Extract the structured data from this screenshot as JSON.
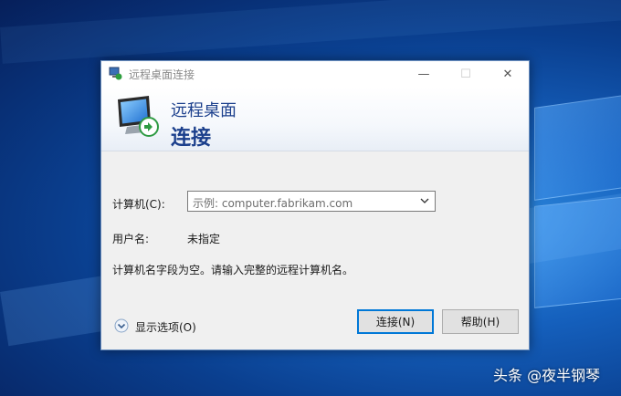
{
  "window": {
    "title": "远程桌面连接",
    "icon": "remote-desktop-icon",
    "controls": {
      "minimize_glyph": "—",
      "maximize_glyph": "☐",
      "close_glyph": "✕"
    }
  },
  "banner": {
    "line1": "远程桌面",
    "line2": "连接"
  },
  "form": {
    "computer_label": "计算机(C):",
    "computer_value": "示例: computer.fabrikam.com",
    "username_label": "用户名:",
    "username_value": "未指定",
    "message": "计算机名字段为空。请输入完整的远程计算机名。"
  },
  "footer": {
    "show_options": "显示选项(O)",
    "connect_button": "连接(N)",
    "help_button": "帮助(H)"
  },
  "watermark": "头条 @夜半钢琴",
  "colors": {
    "accent": "#0078d7",
    "banner_text": "#1b3f8c"
  }
}
